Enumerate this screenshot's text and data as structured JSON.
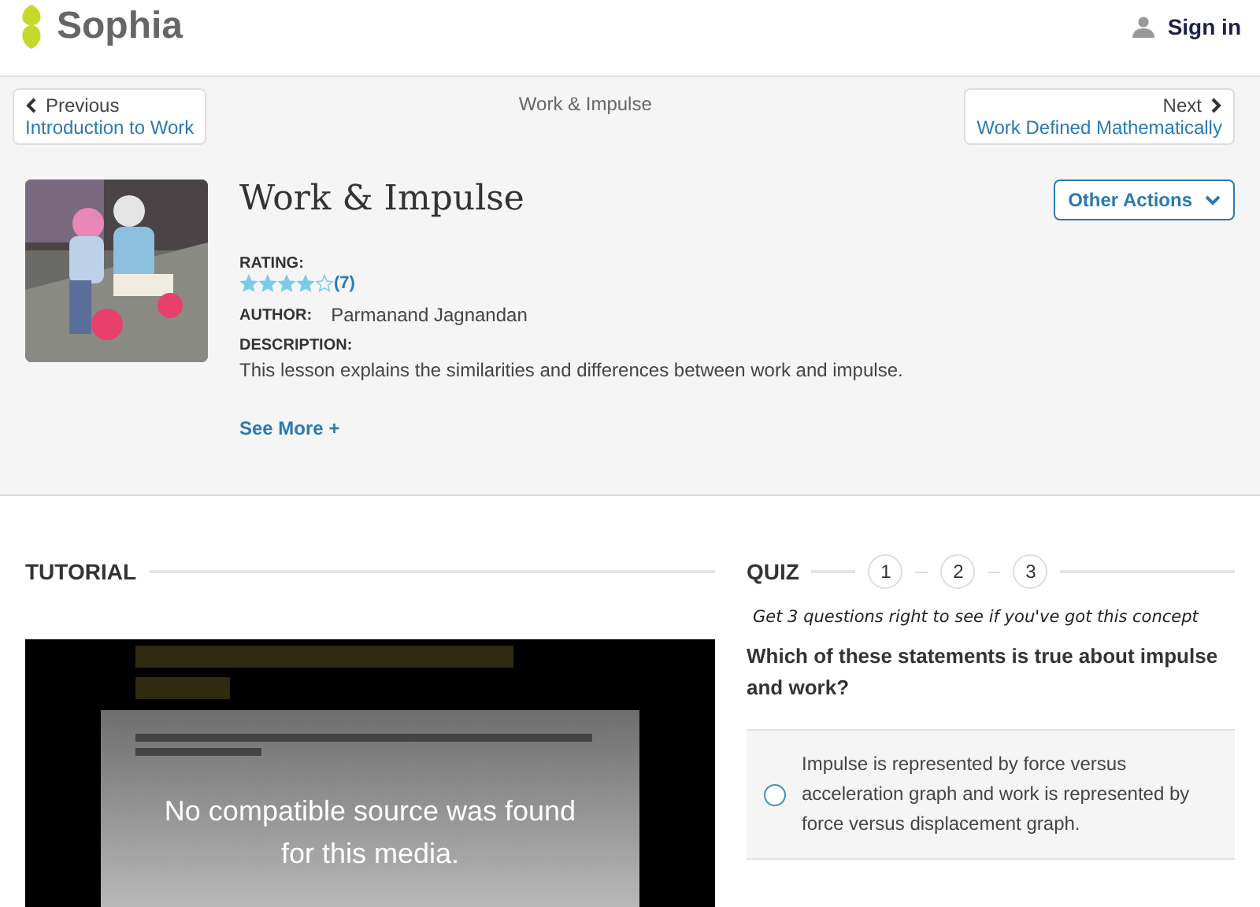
{
  "header": {
    "logo": "Sophia",
    "sign_in": "Sign in"
  },
  "nav": {
    "previous": {
      "label": "Previous",
      "title": "Introduction to Work"
    },
    "current": "Work & Impulse",
    "next": {
      "label": "Next",
      "title": "Work Defined Mathematically"
    }
  },
  "lesson": {
    "title": "Work & Impulse",
    "other_actions": "Other Actions",
    "rating_label": "RATING:",
    "stars": 4,
    "rating_count": "(7)",
    "author_label": "AUTHOR:",
    "author": "Parmanand Jagnandan",
    "description_label": "DESCRIPTION:",
    "description": "This lesson explains the similarities and differences between work and impulse.",
    "see_more": "See More +"
  },
  "tutorial": {
    "heading": "TUTORIAL",
    "video_message": "No compatible source was found for this media."
  },
  "quiz": {
    "heading": "QUIZ",
    "steps": [
      "1",
      "2",
      "3"
    ],
    "tagline": "Get 3 questions right to see if you've got this concept",
    "question": "Which of these statements is true about impulse and work?",
    "answers": [
      {
        "text": "Impulse is represented by force versus acceleration graph and work is represented by force versus displacement graph.",
        "checked": false
      }
    ]
  }
}
